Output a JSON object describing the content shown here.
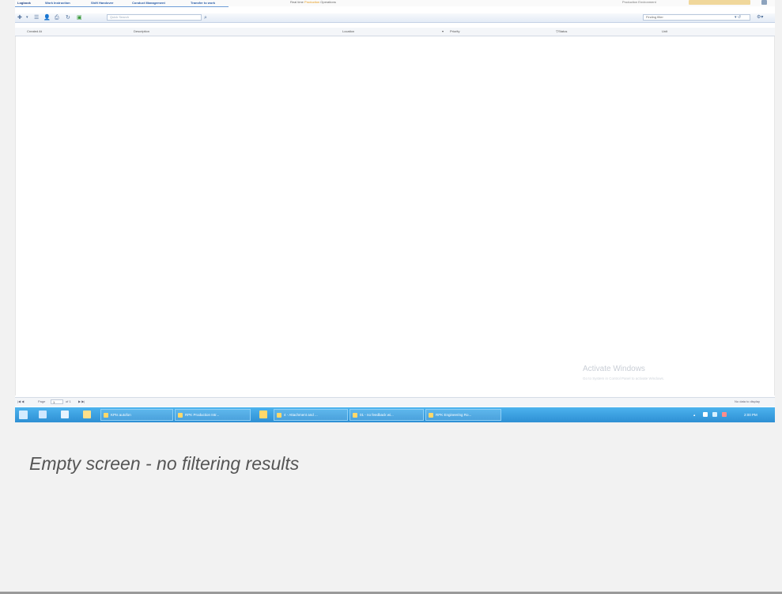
{
  "app": {
    "tabs": [
      "Logbook",
      "Work Instruction",
      "Shift Handover",
      "Conduct Management",
      "Transfer to work"
    ],
    "title_left": "Real time",
    "title_accent": "Production",
    "title_right": "Operations",
    "user_text": "Production Environment"
  },
  "toolbar": {
    "search_placeholder": "Quick Search",
    "filter_value": "Finding filter",
    "filter_controls": "▾ ↺",
    "settings": "⚙▾"
  },
  "grid": {
    "columns": [
      "Created At",
      "Description",
      "Location",
      "Priority",
      "Status",
      "Unit"
    ],
    "rows": []
  },
  "watermark": {
    "title": "Activate Windows",
    "subtitle": "Go to System in Control Panel to activate Windows."
  },
  "pager": {
    "prev": "|◀ ◀",
    "page_label": "Page",
    "page_value": "1",
    "of_label": "of 1",
    "next": "▶ ▶|",
    "status": "No data to display"
  },
  "taskbar": {
    "items": [
      "KPIs autofon",
      "RPK Production Intr...",
      "4 - Attachment and ...",
      "01 - no feedback wi...",
      "RPK Engineering Ro..."
    ],
    "clock": "2:00 PM"
  },
  "caption": "Empty screen - no filtering results",
  "colors": {
    "accent": "#e59a1a",
    "taskbar": "#3ea3e4",
    "tab_text": "#2a5da8"
  }
}
